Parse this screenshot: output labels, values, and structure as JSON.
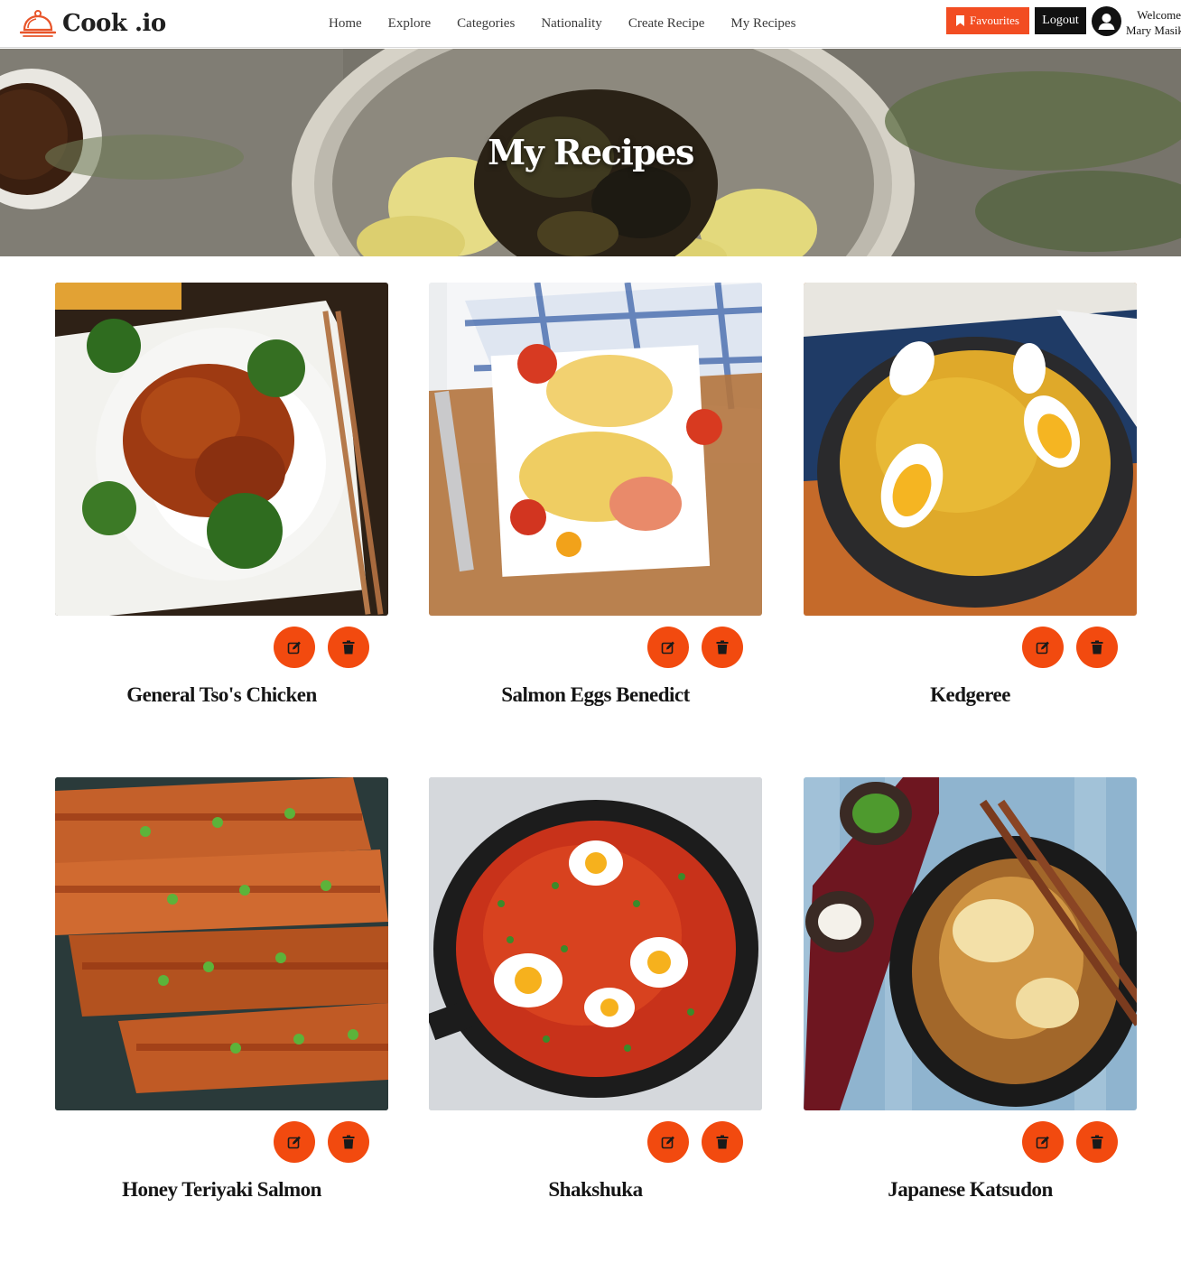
{
  "brand": {
    "name": "Cook .io",
    "icon": "cloche-icon",
    "accent": "#f24d22"
  },
  "nav": {
    "items": [
      "Home",
      "Explore",
      "Categories",
      "Nationality",
      "Create Recipe",
      "My Recipes"
    ]
  },
  "header_actions": {
    "favourites_label": "Favourites",
    "favourites_icon": "bookmark-icon",
    "logout_label": "Logout",
    "avatar_icon": "user-icon",
    "welcome_line1": "Welcome",
    "welcome_line2": "Mary Masiku"
  },
  "hero": {
    "title": "My Recipes"
  },
  "recipes": [
    {
      "title": "General Tso's Chicken",
      "edit_icon": "edit-icon",
      "delete_icon": "trash-icon"
    },
    {
      "title": "Salmon Eggs Benedict",
      "edit_icon": "edit-icon",
      "delete_icon": "trash-icon"
    },
    {
      "title": "Kedgeree",
      "edit_icon": "edit-icon",
      "delete_icon": "trash-icon"
    },
    {
      "title": "Honey Teriyaki Salmon",
      "edit_icon": "edit-icon",
      "delete_icon": "trash-icon"
    },
    {
      "title": "Shakshuka",
      "edit_icon": "edit-icon",
      "delete_icon": "trash-icon"
    },
    {
      "title": "Japanese Katsudon",
      "edit_icon": "edit-icon",
      "delete_icon": "trash-icon"
    }
  ],
  "colors": {
    "action_button": "#f24a0f",
    "logout_button": "#111111",
    "text": "#151515"
  }
}
